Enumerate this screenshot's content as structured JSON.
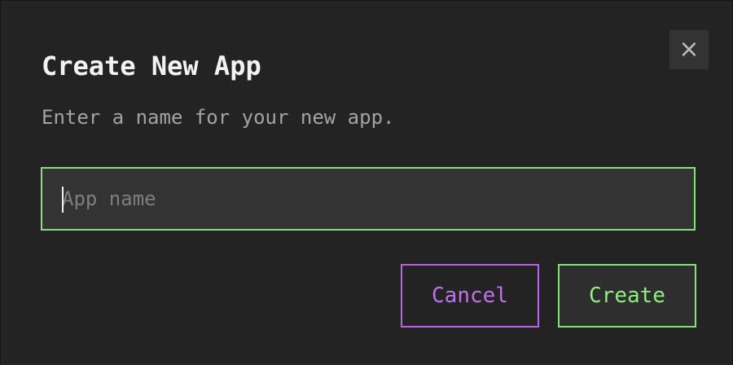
{
  "dialog": {
    "title": "Create New App",
    "description": "Enter a name for your new app.",
    "close_icon": "close-icon",
    "close_glyph": "×",
    "input": {
      "value": "",
      "placeholder": "App name"
    },
    "buttons": {
      "cancel_label": "Cancel",
      "create_label": "Create"
    },
    "colors": {
      "background": "#232323",
      "accent_green": "#86e07a",
      "accent_purple": "#b666e0",
      "title_text": "#f2f2f2",
      "muted_text": "#a3a3a3"
    }
  }
}
